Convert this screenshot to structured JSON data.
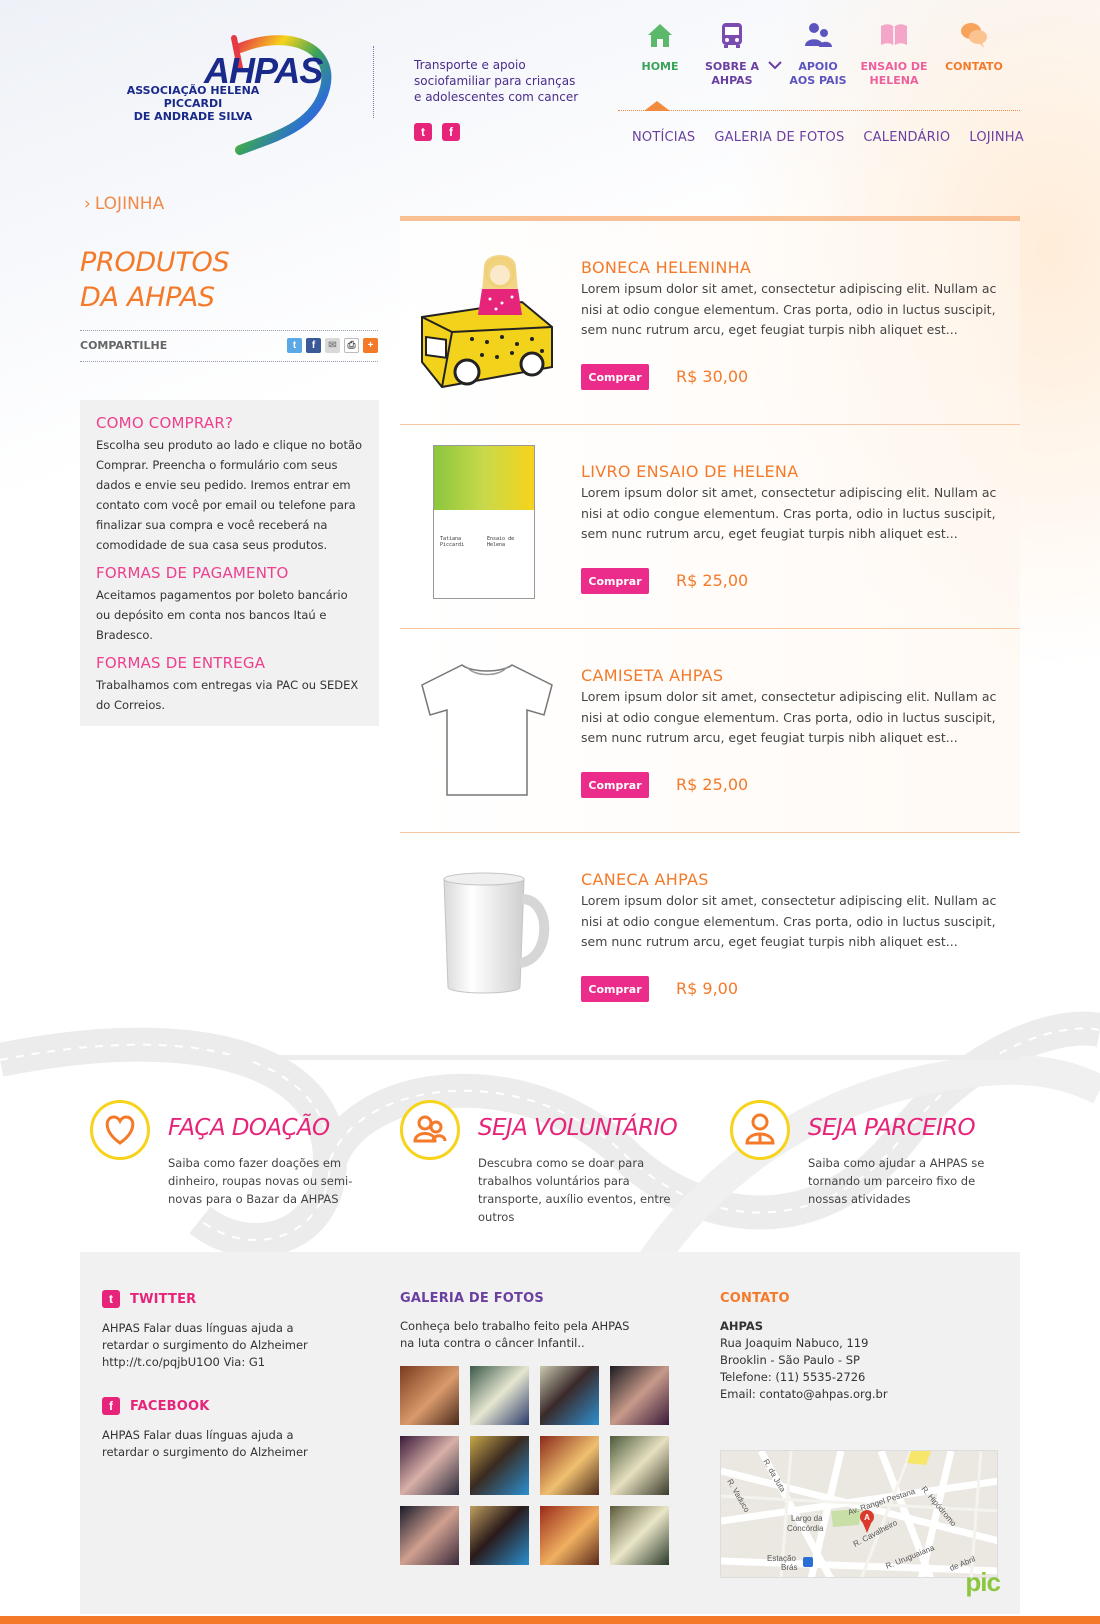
{
  "header": {
    "logo_word": "AHPAS",
    "logo_subtitle_line1": "ASSOCIAÇÃO HELENA PICCARDI",
    "logo_subtitle_line2": "DE ANDRADE SILVA",
    "tagline": "Transporte e apoio sociofamiliar para crianças e adolescentes com cancer",
    "social": {
      "twitter_glyph": "t",
      "facebook_glyph": "f"
    }
  },
  "nav": {
    "items": [
      {
        "label": "HOME",
        "color": "#3aa35a",
        "icon": "home-icon"
      },
      {
        "label_line1": "SOBRE A",
        "label_line2": "AHPAS",
        "color": "#6a3fa0",
        "icon": "bus-icon"
      },
      {
        "label_line1": "APOIO",
        "label_line2": "AOS PAIS",
        "color": "#5c55c0",
        "icon": "people-icon"
      },
      {
        "label_line1": "ENSAIO DE",
        "label_line2": "HELENA",
        "color": "#ee5f9d",
        "icon": "book-icon"
      },
      {
        "label": "CONTATO",
        "color": "#f47a2a",
        "icon": "chat-icon"
      }
    ],
    "subnav": [
      "NOTÍCIAS",
      "GALERIA DE FOTOS",
      "CALENDÁRIO",
      "LOJINHA"
    ]
  },
  "breadcrumb": "LOJINHA",
  "page_title_line1": "PRODUTOS",
  "page_title_line2": "DA AHPAS",
  "share_label": "COMPARTILHE",
  "how_box": {
    "how_title": "COMO COMPRAR?",
    "how_text": "Escolha seu produto ao lado e clique no botão Comprar. Preencha o formulário com seus dados e envie seu pedido. Iremos entrar em contato com você por email ou telefone para finalizar sua compra e você receberá na comodidade de sua casa seus produtos.",
    "pay_title": "FORMAS DE PAGAMENTO",
    "pay_text": "Aceitamos pagamentos por boleto bancário ou depósito em conta nos bancos Itaú e Bradesco.",
    "ship_title": "FORMAS DE ENTREGA",
    "ship_text": "Trabalhamos com entregas via PAC ou SEDEX do Correios."
  },
  "products": [
    {
      "name": "BONECA HELENINHA",
      "desc": "Lorem ipsum dolor sit amet, consectetur adipiscing elit. Nullam ac nisi at odio congue elementum. Cras porta, odio in luctus suscipit, sem nunc rutrum arcu, eget feugiat turpis nibh aliquet est...",
      "buy": "Comprar",
      "price": "R$ 30,00"
    },
    {
      "name": "LIVRO ENSAIO DE HELENA",
      "desc": "Lorem ipsum dolor sit amet, consectetur adipiscing elit. Nullam ac nisi at odio congue elementum. Cras porta, odio in luctus suscipit, sem nunc rutrum arcu, eget feugiat turpis nibh aliquet est...",
      "buy": "Comprar",
      "price": "R$ 25,00",
      "book_author": "Tatiana Piccardi",
      "book_title": "Ensaio de Helena"
    },
    {
      "name": "CAMISETA AHPAS",
      "desc": "Lorem ipsum dolor sit amet, consectetur adipiscing elit. Nullam ac nisi at odio congue elementum. Cras porta, odio in luctus suscipit, sem nunc rutrum arcu, eget feugiat turpis nibh aliquet est...",
      "buy": "Comprar",
      "price": "R$ 25,00"
    },
    {
      "name": "CANECA AHPAS",
      "desc": "Lorem ipsum dolor sit amet, consectetur adipiscing elit. Nullam ac nisi at odio congue elementum. Cras porta, odio in luctus suscipit, sem nunc rutrum arcu, eget feugiat turpis nibh aliquet est...",
      "buy": "Comprar",
      "price": "R$ 9,00"
    }
  ],
  "cta": [
    {
      "title": "FAÇA DOAÇÃO",
      "text": "Saiba como fazer doações em dinheiro, roupas novas ou semi-novas para o Bazar da AHPAS",
      "icon": "heart-icon"
    },
    {
      "title": "SEJA VOLUNTÁRIO",
      "text": "Descubra como se doar para trabalhos voluntários para transporte, auxílio eventos, entre outros",
      "icon": "volunteers-icon"
    },
    {
      "title": "SEJA PARCEIRO",
      "text": "Saiba como ajudar a AHPAS se tornando um parceiro fixo de nossas atividades",
      "icon": "partner-icon"
    }
  ],
  "footer": {
    "twitter_title": "TWITTER",
    "twitter_line1": "AHPAS Falar duas línguas ajuda a",
    "twitter_line2": "retardar o surgimento do Alzheimer",
    "twitter_line3": "http://t.co/pqjbU1O0 Via: G1",
    "facebook_title": "FACEBOOK",
    "facebook_line1": "AHPAS Falar duas línguas ajuda a",
    "facebook_line2": "retardar o surgimento do Alzheimer",
    "gallery_title": "GALERIA DE FOTOS",
    "gallery_line1": "Conheça belo trabalho feito pela AHPAS",
    "gallery_line2": "na luta contra o câncer Infantil..",
    "contact_title": "CONTATO",
    "contact_name": "AHPAS",
    "contact_address": "Rua Joaquim Nabuco, 119",
    "contact_city": "Brooklin - São Paulo - SP",
    "contact_phone": "Telefone: (11) 5535-2726",
    "contact_email": "Email: contato@ahpas.org.br",
    "map_labels": {
      "largo_line1": "Largo da",
      "largo_line2": "Concórdia",
      "estacao_line1": "Estação",
      "estacao_line2": "Brás",
      "street1": "R. da Juta",
      "street2": "Av. Rangel Pestana",
      "street3": "R. Hipódromo",
      "street4": "R. Cavalheiro",
      "street5": "R. Uruguaiana",
      "street6": "R. Vaduco",
      "street7": "de Abril",
      "marker": "A"
    },
    "brand": "pic"
  },
  "colors": {
    "orange": "#f47a2a",
    "pink": "#e6247a",
    "purple": "#6a3fa0",
    "yellow": "#f7d31b",
    "green": "#8cc63f"
  }
}
